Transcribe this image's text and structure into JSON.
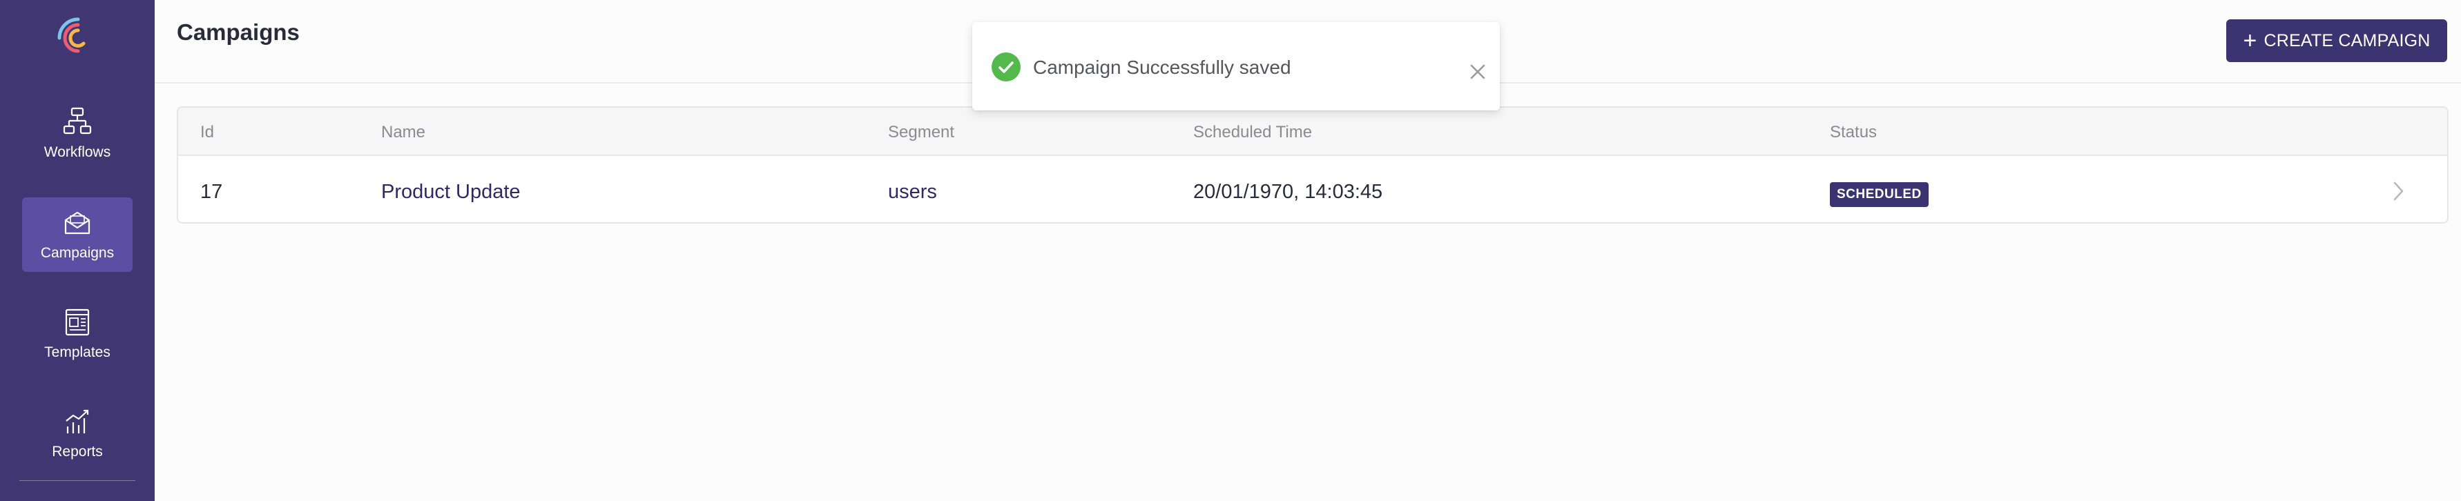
{
  "sidebar": {
    "items": [
      {
        "label": "Workflows",
        "icon": "workflow-icon",
        "active": false
      },
      {
        "label": "Campaigns",
        "icon": "envelope-icon",
        "active": true
      },
      {
        "label": "Templates",
        "icon": "template-icon",
        "active": false
      },
      {
        "label": "Reports",
        "icon": "reports-icon",
        "active": false
      }
    ]
  },
  "header": {
    "title": "Campaigns",
    "create_button_label": "CREATE CAMPAIGN"
  },
  "toast": {
    "message": "Campaign Successfully saved",
    "icon": "check-circle-icon"
  },
  "table": {
    "columns": [
      "Id",
      "Name",
      "Segment",
      "Scheduled Time",
      "Status"
    ],
    "rows": [
      {
        "id": "17",
        "name": "Product Update",
        "segment": "users",
        "scheduled_time": "20/01/1970, 14:03:45",
        "status": "SCHEDULED"
      }
    ]
  },
  "colors": {
    "sidebar_bg": "#3f3672",
    "sidebar_active": "#5b4ea3",
    "primary_button": "#3b3470",
    "success_green": "#52b94a"
  }
}
